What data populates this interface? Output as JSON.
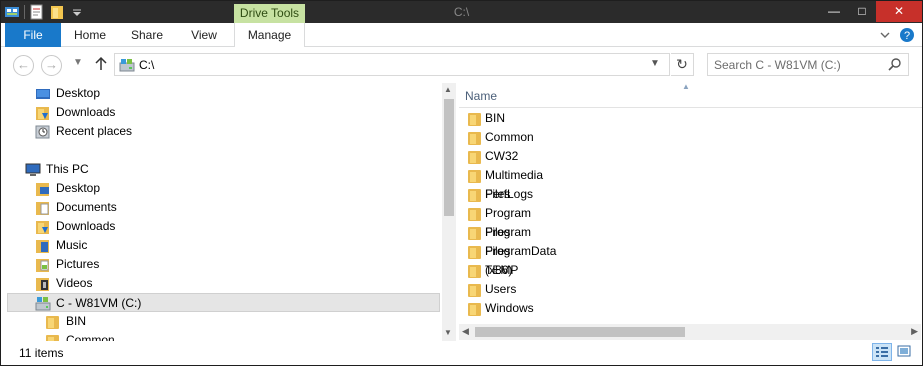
{
  "window": {
    "title": "C:\\",
    "context_tab": "Drive Tools"
  },
  "ribbon": {
    "tabs": [
      "File",
      "Home",
      "Share",
      "View",
      "Manage"
    ]
  },
  "address": {
    "path": "C:\\",
    "search_placeholder": "Search C - W81VM (C:)"
  },
  "nav_tree": [
    {
      "label": "Desktop",
      "icon": "desktop-icon"
    },
    {
      "label": "Downloads",
      "icon": "downloads-folder-icon"
    },
    {
      "label": "Recent places",
      "icon": "recent-places-icon"
    },
    {
      "label": "This PC",
      "icon": "computer-icon"
    },
    {
      "label": "Desktop",
      "icon": "desktop-folder-icon"
    },
    {
      "label": "Documents",
      "icon": "documents-folder-icon"
    },
    {
      "label": "Downloads",
      "icon": "downloads-folder-icon"
    },
    {
      "label": "Music",
      "icon": "music-folder-icon"
    },
    {
      "label": "Pictures",
      "icon": "pictures-folder-icon"
    },
    {
      "label": "Videos",
      "icon": "videos-folder-icon"
    },
    {
      "label": "C - W81VM (C:)",
      "icon": "drive-icon",
      "selected": true
    },
    {
      "label": "BIN",
      "icon": "folder-icon"
    },
    {
      "label": "Common",
      "icon": "folder-icon"
    }
  ],
  "content": {
    "column_name": "Name",
    "items": [
      "BIN",
      "Common",
      "CW32",
      "Multimedia Files",
      "PerfLogs",
      "Program Files",
      "Program Files (x86)",
      "ProgramData",
      "TEMP",
      "Users",
      "Windows"
    ]
  },
  "status": {
    "item_count": "11 items"
  },
  "colors": {
    "file_tab": "#1979ca",
    "drive_tools": "#c7e2a2",
    "close_button": "#c7302a",
    "folder": "#e9b94e"
  }
}
